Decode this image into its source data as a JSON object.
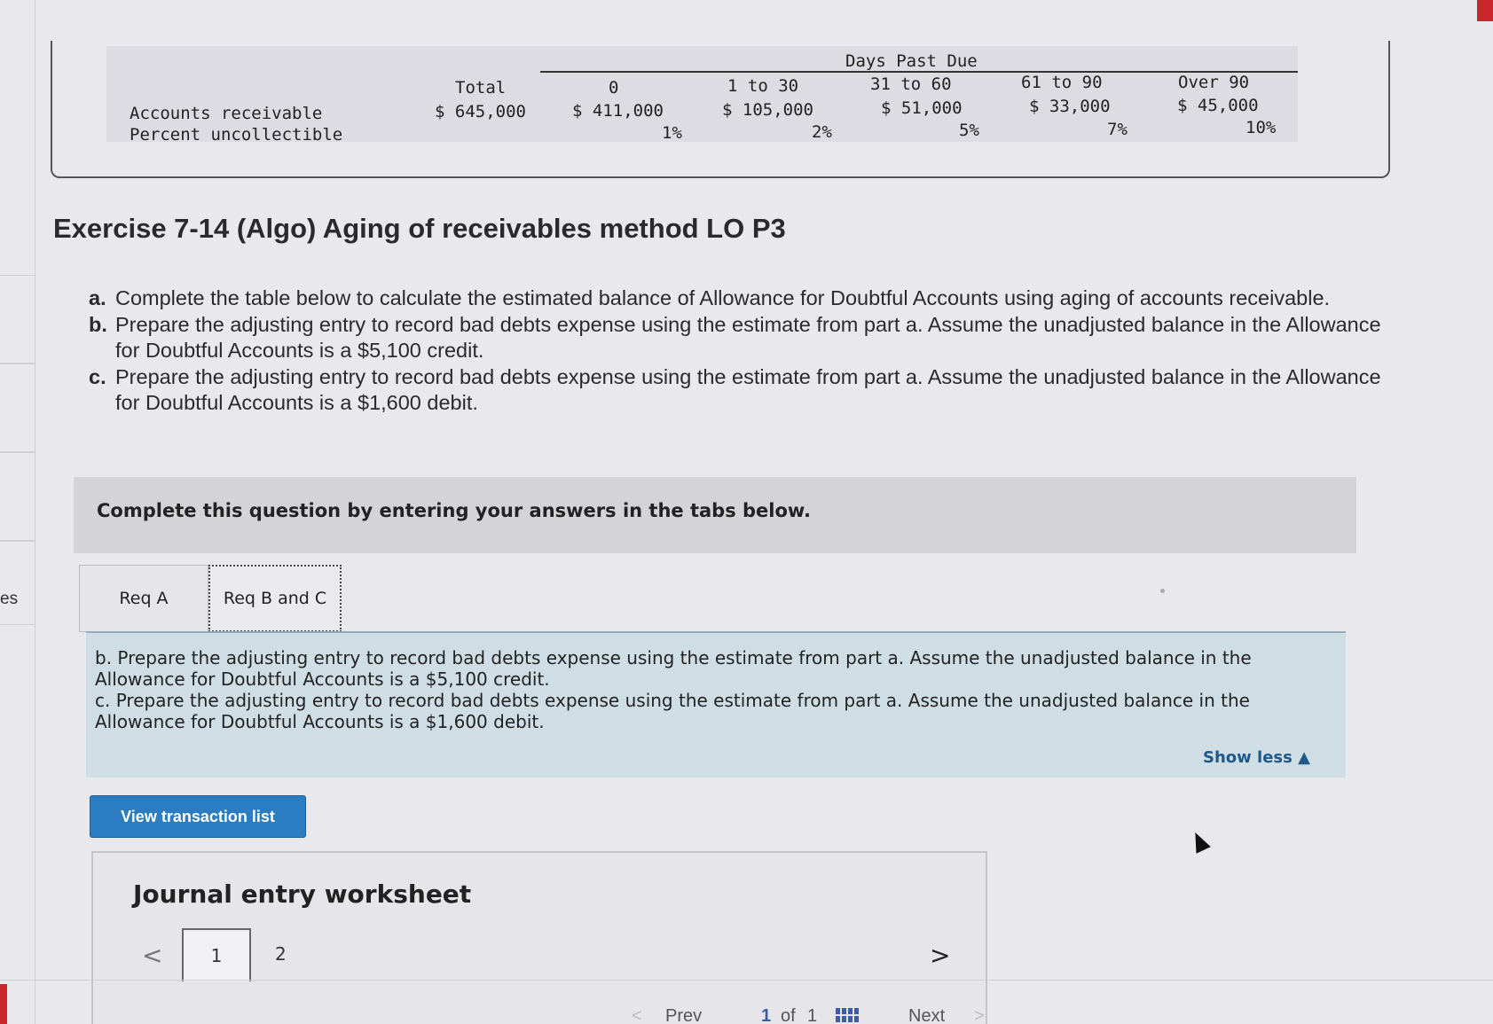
{
  "side_label": "es",
  "aging_table": {
    "group_header": "Days Past Due",
    "columns": [
      "Total",
      "0",
      "1 to 30",
      "31 to 60",
      "61 to 90",
      "Over 90"
    ],
    "rows": [
      {
        "label": "Accounts receivable",
        "values": [
          "$ 645,000",
          "$ 411,000",
          "$ 105,000",
          "$ 51,000",
          "$ 33,000",
          "$ 45,000"
        ]
      },
      {
        "label": "Percent uncollectible",
        "values": [
          "",
          "1%",
          "2%",
          "5%",
          "7%",
          "10%"
        ]
      }
    ]
  },
  "title": "Exercise 7-14 (Algo) Aging of receivables method LO P3",
  "instructions": [
    {
      "marker": "a.",
      "text": "Complete the table below to calculate the estimated balance of Allowance for Doubtful Accounts using aging of accounts receivable."
    },
    {
      "marker": "b.",
      "text": "Prepare the adjusting entry to record bad debts expense using the estimate from part a. Assume the unadjusted balance in the Allowance for Doubtful Accounts is a $5,100 credit."
    },
    {
      "marker": "c.",
      "text": "Prepare the adjusting entry to record bad debts expense using the estimate from part a. Assume the unadjusted balance in the Allowance for Doubtful Accounts is a $1,600 debit."
    }
  ],
  "complete_prompt": "Complete this question by entering your answers in the tabs below.",
  "tabs": [
    {
      "label": "Req A",
      "active": false
    },
    {
      "label": "Req B and C",
      "active": true
    }
  ],
  "req_panel": {
    "lines": [
      "b. Prepare the adjusting entry to record bad debts expense using the estimate from part a. Assume the unadjusted balance in the",
      "Allowance for Doubtful Accounts is a $5,100 credit.",
      "c. Prepare the adjusting entry to record bad debts expense using the estimate from part a. Assume the unadjusted balance in the",
      "Allowance for Doubtful Accounts is a $1,600 debit."
    ],
    "show_less": "Show less"
  },
  "view_button": "View transaction list",
  "worksheet": {
    "title": "Journal entry worksheet",
    "pages": [
      "1",
      "2"
    ],
    "prev_icon": "chevron-left-icon",
    "next_icon": "chevron-right-icon"
  },
  "pager": {
    "prev": "Prev",
    "current": "1",
    "of_label": "of",
    "total": "1",
    "next": "Next"
  },
  "colors": {
    "button_blue": "#2b7cc0",
    "panel_blue": "#cfdde4",
    "link_blue": "#1d5a8a",
    "accent_red": "#c8262a"
  }
}
